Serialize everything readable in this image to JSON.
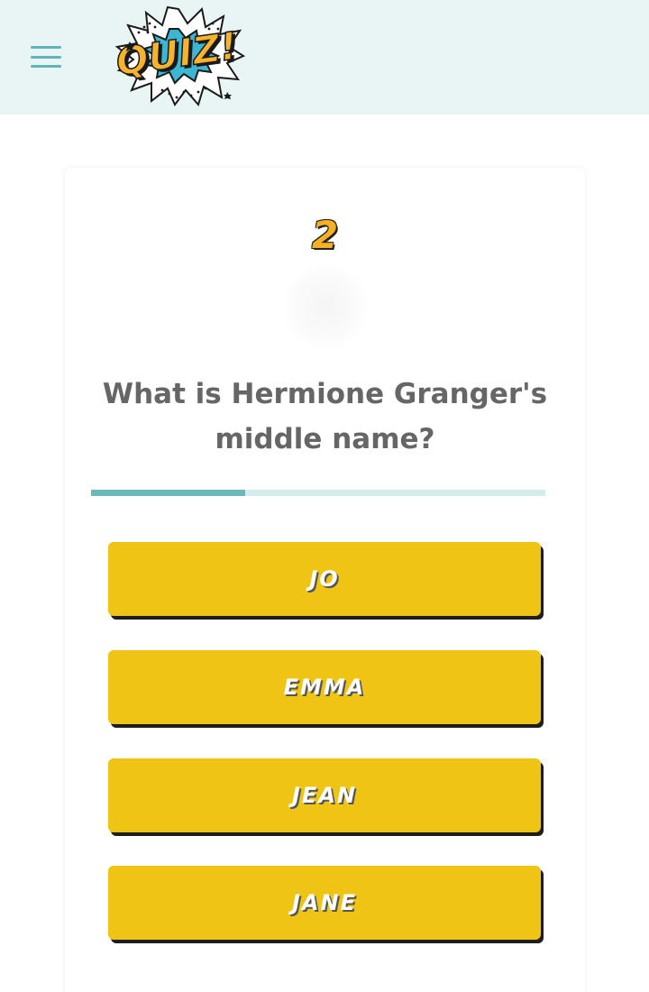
{
  "header": {
    "menu_icon": "hamburger-menu-icon",
    "logo": {
      "text": "QUIZ!",
      "colors": {
        "text": "#f7b32b",
        "burst": "#3bb6d4",
        "outline": "#1a1a1a"
      }
    }
  },
  "quiz": {
    "question_number": "2",
    "question": "What is Hermione Granger's middle name?",
    "progress_fraction": 0.34,
    "answers": [
      {
        "label": "JO"
      },
      {
        "label": "EMMA"
      },
      {
        "label": "JEAN"
      },
      {
        "label": "JANE"
      }
    ]
  },
  "colors": {
    "header_bg": "#e9f5f5",
    "accent": "#5fb5b9",
    "answer_bg": "#f0c415",
    "number": "#f5b024",
    "question_text": "#666666"
  }
}
